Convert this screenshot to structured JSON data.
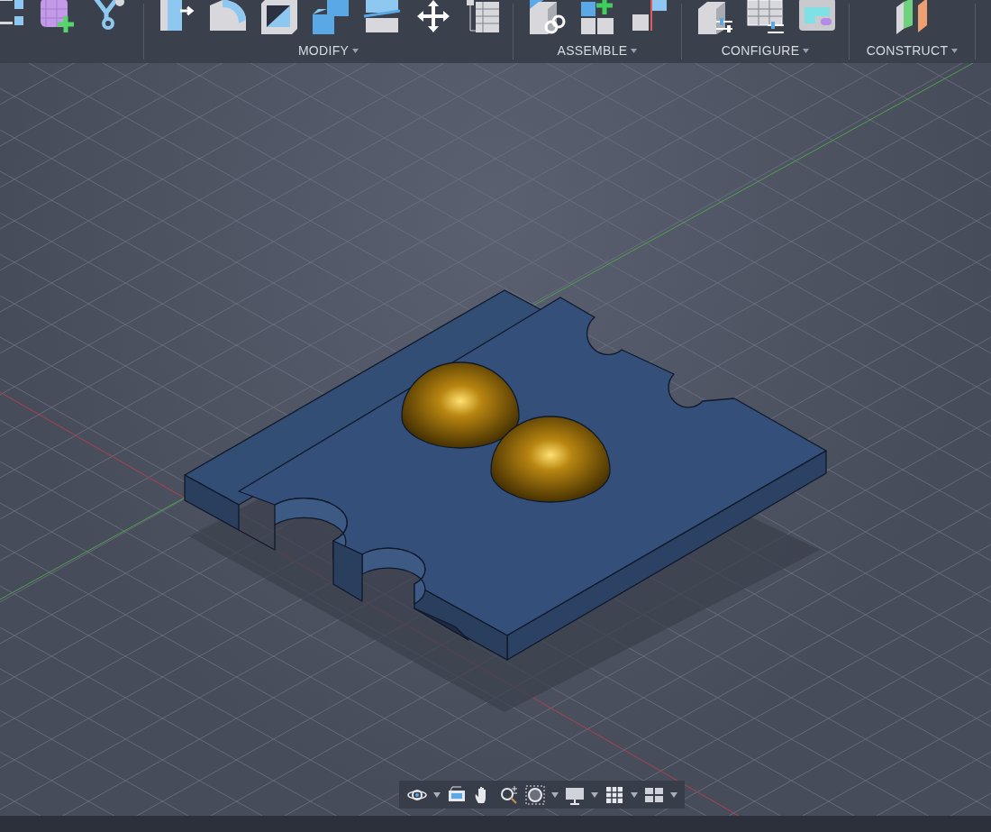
{
  "toolbar": {
    "groups": [
      {
        "label": "MODIFY"
      },
      {
        "label": "ASSEMBLE"
      },
      {
        "label": "CONFIGURE"
      },
      {
        "label": "CONSTRUCT"
      }
    ]
  }
}
